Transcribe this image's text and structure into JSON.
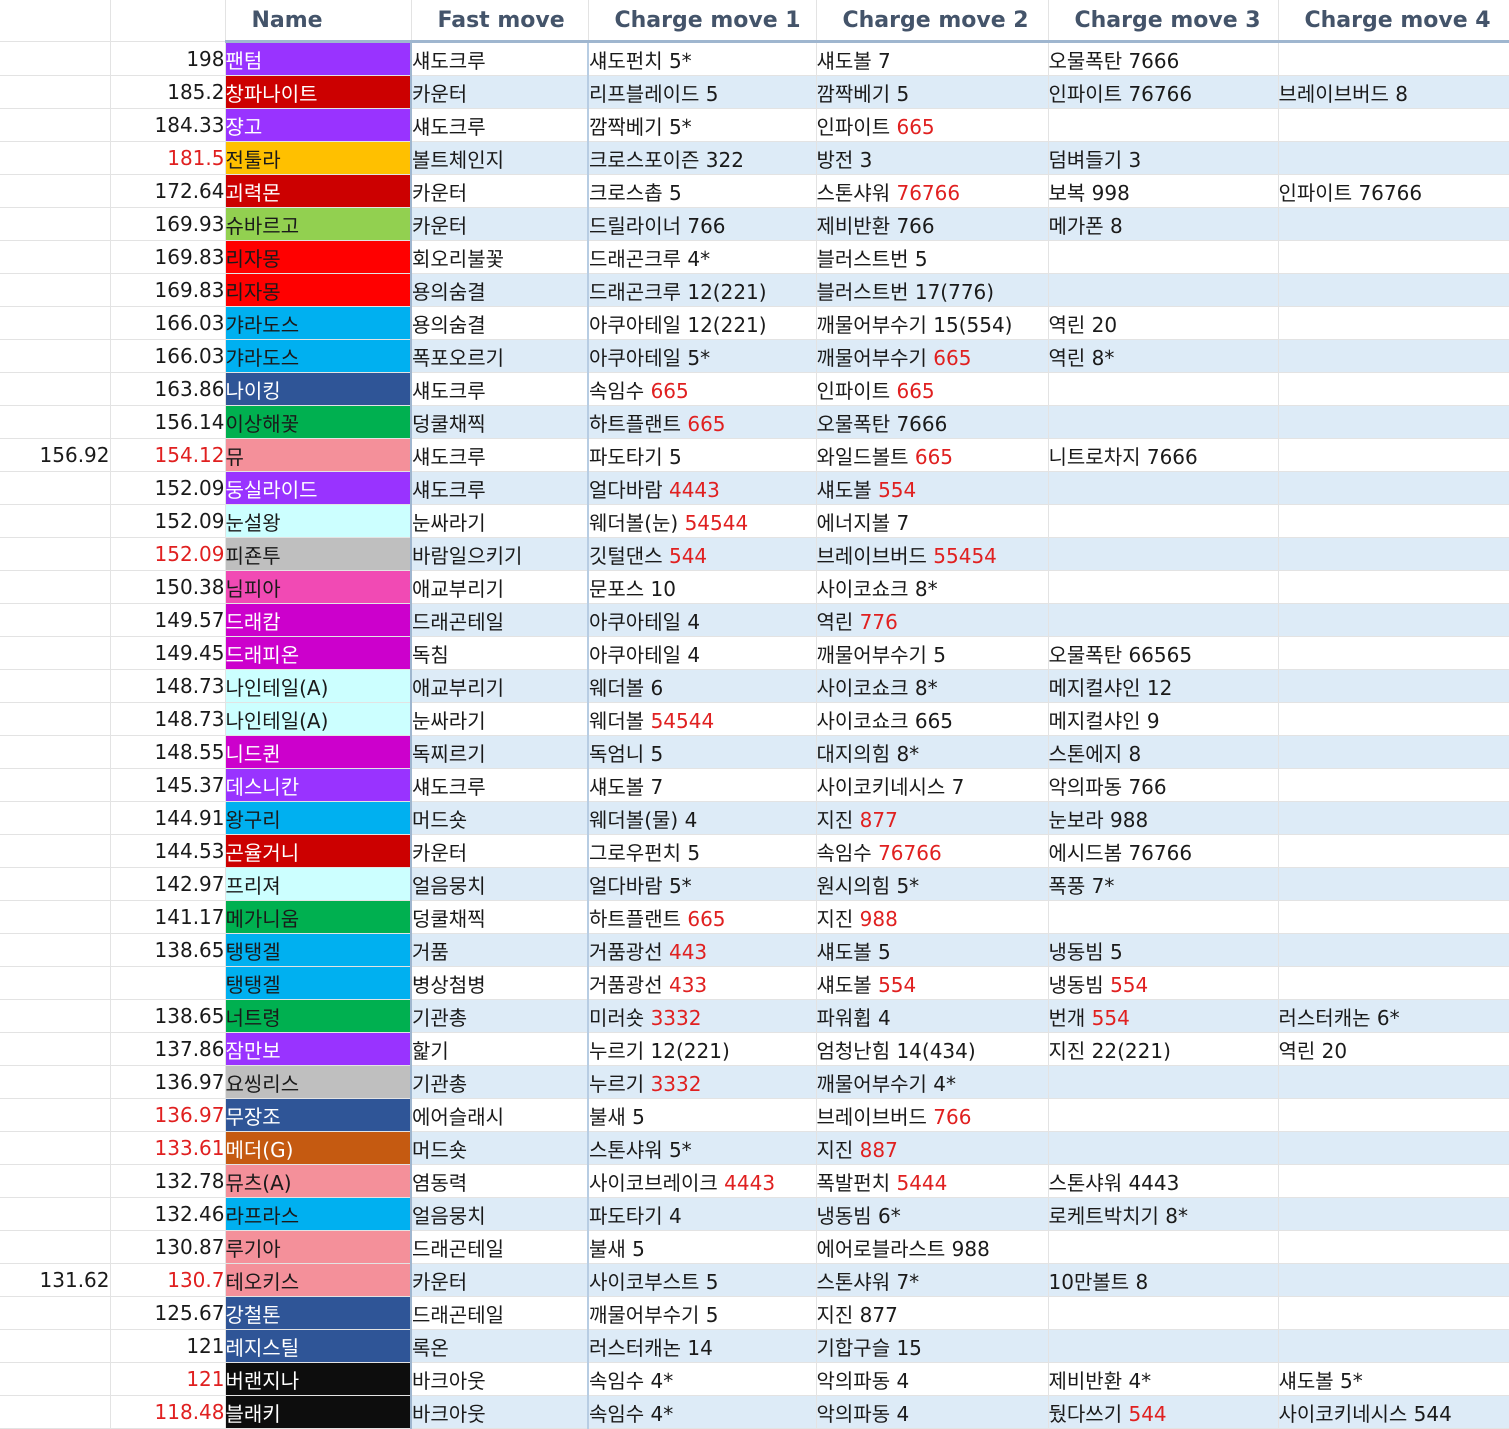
{
  "headers": [
    "",
    "",
    "Name",
    "Fast move",
    "Charge move 1",
    "Charge move 2",
    "Charge move 3",
    "Charge move 4"
  ],
  "rows": [
    {
      "a": "",
      "b": "198",
      "name": "팬텀",
      "color": "#9933ff",
      "fast": "섀도크루",
      "m1": [
        "섀도펀치 5*",
        ""
      ],
      "m2": [
        "섀도볼 7",
        ""
      ],
      "m3": [
        "오물폭탄 7666",
        ""
      ],
      "m4": [
        "",
        ""
      ]
    },
    {
      "a": "",
      "b": "185.2",
      "name": "창파나이트",
      "color": "#cc0000",
      "fast": "카운터",
      "m1": [
        "리프블레이드 5",
        ""
      ],
      "m2": [
        "깜짝베기 5",
        ""
      ],
      "m3": [
        "인파이트 76766",
        ""
      ],
      "m4": [
        "브레이브버드 8",
        ""
      ]
    },
    {
      "a": "",
      "b": "184.33",
      "name": "쟝고",
      "color": "#9933ff",
      "fast": "섀도크루",
      "m1": [
        "깜짝베기 5*",
        ""
      ],
      "m2": [
        "인파이트 ",
        "665"
      ],
      "m3": [
        "",
        ""
      ],
      "m4": [
        "",
        ""
      ]
    },
    {
      "a": "",
      "b": "181.5",
      "bred": true,
      "name": "전툴라",
      "color": "#ffc000",
      "dark": true,
      "fast": "볼트체인지",
      "m1": [
        "크로스포이즌 322",
        ""
      ],
      "m2": [
        "방전 3",
        ""
      ],
      "m3": [
        "덤벼들기 3",
        ""
      ],
      "m4": [
        "",
        ""
      ]
    },
    {
      "a": "",
      "b": "172.64",
      "name": "괴력몬",
      "color": "#cc0000",
      "fast": "카운터",
      "m1": [
        "크로스촙 5",
        ""
      ],
      "m2": [
        "스톤샤워 ",
        "76766"
      ],
      "m3": [
        "보복 998",
        ""
      ],
      "m4": [
        "인파이트 76766",
        ""
      ]
    },
    {
      "a": "",
      "b": "169.93",
      "name": "슈바르고",
      "color": "#92d050",
      "dark": true,
      "fast": "카운터",
      "m1": [
        "드릴라이너 766",
        ""
      ],
      "m2": [
        "제비반환 766",
        ""
      ],
      "m3": [
        "메가폰 8",
        ""
      ],
      "m4": [
        "",
        ""
      ]
    },
    {
      "a": "",
      "b": "169.83",
      "name": "리자몽",
      "color": "#ff0000",
      "dark": true,
      "fast": "회오리불꽃",
      "m1": [
        "드래곤크루 4*",
        ""
      ],
      "m2": [
        "블러스트번 5",
        ""
      ],
      "m3": [
        "",
        ""
      ],
      "m4": [
        "",
        ""
      ]
    },
    {
      "a": "",
      "b": "169.83",
      "name": "리자몽",
      "color": "#ff0000",
      "dark": true,
      "fast": "용의숨결",
      "m1": [
        "드래곤크루 12(221)",
        ""
      ],
      "m2": [
        "블러스트번 17(776)",
        ""
      ],
      "m3": [
        "",
        ""
      ],
      "m4": [
        "",
        ""
      ]
    },
    {
      "a": "",
      "b": "166.03",
      "name": "갸라도스",
      "color": "#00b0f0",
      "dark": true,
      "fast": "용의숨결",
      "m1": [
        "아쿠아테일 12(221)",
        ""
      ],
      "m2": [
        "깨물어부수기 15(554)",
        ""
      ],
      "m3": [
        "역린 20",
        ""
      ],
      "m4": [
        "",
        ""
      ]
    },
    {
      "a": "",
      "b": "166.03",
      "name": "갸라도스",
      "color": "#00b0f0",
      "dark": true,
      "fast": "폭포오르기",
      "m1": [
        "아쿠아테일 5*",
        ""
      ],
      "m2": [
        "깨물어부수기 ",
        "665"
      ],
      "m3": [
        "역린 8*",
        ""
      ],
      "m4": [
        "",
        ""
      ]
    },
    {
      "a": "",
      "b": "163.86",
      "name": "나이킹",
      "color": "#2f5597",
      "fast": "섀도크루",
      "m1": [
        "속임수 ",
        "665"
      ],
      "m2": [
        "인파이트 ",
        "665"
      ],
      "m3": [
        "",
        ""
      ],
      "m4": [
        "",
        ""
      ]
    },
    {
      "a": "",
      "b": "156.14",
      "name": "이상해꽃",
      "color": "#00b050",
      "dark": true,
      "fast": "덩쿨채찍",
      "m1": [
        "하트플랜트 ",
        "665"
      ],
      "m2": [
        "오물폭탄 7666",
        ""
      ],
      "m3": [
        "",
        ""
      ],
      "m4": [
        "",
        ""
      ]
    },
    {
      "a": "156.92",
      "b": "154.12",
      "bred": true,
      "name": "뮤",
      "color": "#f4909a",
      "dark": true,
      "fast": "섀도크루",
      "m1": [
        "파도타기 5",
        ""
      ],
      "m2": [
        "와일드볼트 ",
        "665"
      ],
      "m3": [
        "니트로차지 7666",
        ""
      ],
      "m4": [
        "",
        ""
      ]
    },
    {
      "a": "",
      "b": "152.09",
      "name": "둥실라이드",
      "color": "#9933ff",
      "fast": "섀도크루",
      "m1": [
        "얼다바람 ",
        "4443"
      ],
      "m2": [
        "섀도볼 ",
        "554"
      ],
      "m3": [
        "",
        ""
      ],
      "m4": [
        "",
        ""
      ]
    },
    {
      "a": "",
      "b": "152.09",
      "name": "눈설왕",
      "color": "#ccffff",
      "dark": true,
      "fast": "눈싸라기",
      "m1": [
        "웨더볼(눈) ",
        "54544"
      ],
      "m2": [
        "에너지볼 7",
        ""
      ],
      "m3": [
        "",
        ""
      ],
      "m4": [
        "",
        ""
      ]
    },
    {
      "a": "",
      "b": "152.09",
      "bred": true,
      "name": "피죤투",
      "color": "#bfbfbf",
      "dark": true,
      "fast": "바람일으키기",
      "m1": [
        "깃털댄스 ",
        "544"
      ],
      "m2": [
        "브레이브버드 ",
        "55454"
      ],
      "m3": [
        "",
        ""
      ],
      "m4": [
        "",
        ""
      ]
    },
    {
      "a": "",
      "b": "150.38",
      "name": "님피아",
      "color": "#f14ab4",
      "dark": true,
      "fast": "애교부리기",
      "m1": [
        "문포스 10",
        ""
      ],
      "m2": [
        "사이코쇼크 8*",
        ""
      ],
      "m3": [
        "",
        ""
      ],
      "m4": [
        "",
        ""
      ]
    },
    {
      "a": "",
      "b": "149.57",
      "name": "드래캄",
      "color": "#cc00cc",
      "fast": "드래곤테일",
      "m1": [
        "아쿠아테일 4",
        ""
      ],
      "m2": [
        "역린 ",
        "776"
      ],
      "m3": [
        "",
        ""
      ],
      "m4": [
        "",
        ""
      ]
    },
    {
      "a": "",
      "b": "149.45",
      "name": "드래피온",
      "color": "#cc00cc",
      "fast": "독침",
      "m1": [
        "아쿠아테일 4",
        ""
      ],
      "m2": [
        "깨물어부수기 5",
        ""
      ],
      "m3": [
        "오물폭탄 66565",
        ""
      ],
      "m4": [
        "",
        ""
      ]
    },
    {
      "a": "",
      "b": "148.73",
      "name": "나인테일(A)",
      "color": "#ccffff",
      "dark": true,
      "fast": "애교부리기",
      "m1": [
        "웨더볼 6",
        ""
      ],
      "m2": [
        "사이코쇼크 8*",
        ""
      ],
      "m3": [
        "메지컬샤인 12",
        ""
      ],
      "m4": [
        "",
        ""
      ]
    },
    {
      "a": "",
      "b": "148.73",
      "name": "나인테일(A)",
      "color": "#ccffff",
      "dark": true,
      "fast": "눈싸라기",
      "m1": [
        "웨더볼 ",
        "54544"
      ],
      "m2": [
        "사이코쇼크 665",
        ""
      ],
      "m3": [
        "메지컬샤인 9",
        ""
      ],
      "m4": [
        "",
        ""
      ]
    },
    {
      "a": "",
      "b": "148.55",
      "name": "니드퀸",
      "color": "#cc00cc",
      "fast": "독찌르기",
      "m1": [
        "독엄니 5",
        ""
      ],
      "m2": [
        "대지의힘 8*",
        ""
      ],
      "m3": [
        "스톤에지 8",
        ""
      ],
      "m4": [
        "",
        ""
      ]
    },
    {
      "a": "",
      "b": "145.37",
      "name": "데스니칸",
      "color": "#9933ff",
      "fast": "섀도크루",
      "m1": [
        "섀도볼 7",
        ""
      ],
      "m2": [
        "사이코키네시스 7",
        ""
      ],
      "m3": [
        "악의파동 766",
        ""
      ],
      "m4": [
        "",
        ""
      ]
    },
    {
      "a": "",
      "b": "144.91",
      "name": "왕구리",
      "color": "#00b0f0",
      "dark": true,
      "fast": "머드숏",
      "m1": [
        "웨더볼(물) 4",
        ""
      ],
      "m2": [
        "지진 ",
        "877"
      ],
      "m3": [
        "눈보라 988",
        ""
      ],
      "m4": [
        "",
        ""
      ]
    },
    {
      "a": "",
      "b": "144.53",
      "name": "곤율거니",
      "color": "#cc0000",
      "fast": "카운터",
      "m1": [
        "그로우펀치 5",
        ""
      ],
      "m2": [
        "속임수 ",
        "76766"
      ],
      "m3": [
        "에시드봄 76766",
        ""
      ],
      "m4": [
        "",
        ""
      ]
    },
    {
      "a": "",
      "b": "142.97",
      "name": "프리져",
      "color": "#ccffff",
      "dark": true,
      "fast": "얼음뭉치",
      "m1": [
        "얼다바람 5*",
        ""
      ],
      "m2": [
        "원시의힘 5*",
        ""
      ],
      "m3": [
        "폭풍 7*",
        ""
      ],
      "m4": [
        "",
        ""
      ]
    },
    {
      "a": "",
      "b": "141.17",
      "name": "메가니움",
      "color": "#00b050",
      "dark": true,
      "fast": "덩쿨채찍",
      "m1": [
        "하트플랜트 ",
        "665"
      ],
      "m2": [
        "지진 ",
        "988"
      ],
      "m3": [
        "",
        ""
      ],
      "m4": [
        "",
        ""
      ]
    },
    {
      "a": "",
      "b": "138.65",
      "name": "탱탱겔",
      "color": "#00b0f0",
      "dark": true,
      "fast": "거품",
      "m1": [
        "거품광선 ",
        "443"
      ],
      "m2": [
        "섀도볼 5",
        ""
      ],
      "m3": [
        "냉동빔 5",
        ""
      ],
      "m4": [
        "",
        ""
      ]
    },
    {
      "a": "",
      "b": "",
      "name": "탱탱겔",
      "color": "#00b0f0",
      "dark": true,
      "fast": "병상첨병",
      "m1": [
        "거품광선 ",
        "433"
      ],
      "m2": [
        "섀도볼 ",
        "554"
      ],
      "m3": [
        "냉동빔 ",
        "554"
      ],
      "m4": [
        "",
        ""
      ]
    },
    {
      "a": "",
      "b": "138.65",
      "name": "너트령",
      "color": "#00b050",
      "dark": true,
      "fast": "기관총",
      "m1": [
        "미러숏 ",
        "3332"
      ],
      "m2": [
        "파워휩 4",
        ""
      ],
      "m3": [
        "번개 ",
        "554"
      ],
      "m4": [
        "러스터캐논 6*",
        ""
      ]
    },
    {
      "a": "",
      "b": "137.86",
      "name": "잠만보",
      "color": "#9933ff",
      "fast": "핥기",
      "m1": [
        "누르기 12(221)",
        ""
      ],
      "m2": [
        "엄청난힘 14(434)",
        ""
      ],
      "m3": [
        "지진 22(221)",
        ""
      ],
      "m4": [
        "역린 20",
        ""
      ]
    },
    {
      "a": "",
      "b": "136.97",
      "name": "요씽리스",
      "color": "#bfbfbf",
      "dark": true,
      "fast": "기관총",
      "m1": [
        "누르기 ",
        "3332"
      ],
      "m2": [
        "깨물어부수기 4*",
        ""
      ],
      "m3": [
        "",
        ""
      ],
      "m4": [
        "",
        ""
      ]
    },
    {
      "a": "",
      "b": "136.97",
      "bred": true,
      "name": "무장조",
      "color": "#2f5597",
      "fast": "에어슬래시",
      "m1": [
        "불새 5",
        ""
      ],
      "m2": [
        "브레이브버드 ",
        "766"
      ],
      "m3": [
        "",
        ""
      ],
      "m4": [
        "",
        ""
      ]
    },
    {
      "a": "",
      "b": "133.61",
      "bred": true,
      "name": "메더(G)",
      "color": "#c55a11",
      "fast": "머드숏",
      "m1": [
        "스톤샤워 5*",
        ""
      ],
      "m2": [
        "지진 ",
        "887"
      ],
      "m3": [
        "",
        ""
      ],
      "m4": [
        "",
        ""
      ]
    },
    {
      "a": "",
      "b": "132.78",
      "name": "뮤츠(A)",
      "color": "#f4909a",
      "dark": true,
      "fast": "염동력",
      "m1": [
        "사이코브레이크 ",
        "4443"
      ],
      "m2": [
        "폭발펀치 ",
        "5444"
      ],
      "m3": [
        "스톤샤워 4443",
        ""
      ],
      "m4": [
        "",
        ""
      ]
    },
    {
      "a": "",
      "b": "132.46",
      "name": "라프라스",
      "color": "#00b0f0",
      "dark": true,
      "fast": "얼음뭉치",
      "m1": [
        "파도타기 4",
        ""
      ],
      "m2": [
        "냉동빔 6*",
        ""
      ],
      "m3": [
        "로케트박치기 8*",
        ""
      ],
      "m4": [
        "",
        ""
      ]
    },
    {
      "a": "",
      "b": "130.87",
      "name": "루기아",
      "color": "#f4909a",
      "dark": true,
      "fast": "드래곤테일",
      "m1": [
        "불새 5",
        ""
      ],
      "m2": [
        "에어로블라스트 988",
        ""
      ],
      "m3": [
        "",
        ""
      ],
      "m4": [
        "",
        ""
      ]
    },
    {
      "a": "131.62",
      "b": "130.7",
      "bred": true,
      "name": "테오키스",
      "color": "#f4909a",
      "dark": true,
      "fast": "카운터",
      "m1": [
        "사이코부스트 5",
        ""
      ],
      "m2": [
        "스톤샤워 7*",
        ""
      ],
      "m3": [
        "10만볼트 8",
        ""
      ],
      "m4": [
        "",
        ""
      ]
    },
    {
      "a": "",
      "b": "125.67",
      "name": "강철톤",
      "color": "#2f5597",
      "fast": "드래곤테일",
      "m1": [
        "깨물어부수기 5",
        ""
      ],
      "m2": [
        "지진 877",
        ""
      ],
      "m3": [
        "",
        ""
      ],
      "m4": [
        "",
        ""
      ]
    },
    {
      "a": "",
      "b": "121",
      "name": "레지스틸",
      "color": "#2f5597",
      "fast": "록온",
      "m1": [
        "러스터캐논 14",
        ""
      ],
      "m2": [
        "기합구슬 15",
        ""
      ],
      "m3": [
        "",
        ""
      ],
      "m4": [
        "",
        ""
      ]
    },
    {
      "a": "",
      "b": "121",
      "bred": true,
      "name": "버랜지나",
      "color": "#0d0d0d",
      "fast": "바크아웃",
      "m1": [
        "속임수 4*",
        ""
      ],
      "m2": [
        "악의파동 4",
        ""
      ],
      "m3": [
        "제비반환 4*",
        ""
      ],
      "m4": [
        "섀도볼 5*",
        ""
      ]
    },
    {
      "a": "",
      "b": "118.48",
      "bred": true,
      "name": "블래키",
      "color": "#0d0d0d",
      "fast": "바크아웃",
      "m1": [
        "속임수 4*",
        ""
      ],
      "m2": [
        "악의파동 4",
        ""
      ],
      "m3": [
        "뒀다쓰기 ",
        "544"
      ],
      "m4": [
        "사이코키네시스 544",
        ""
      ]
    }
  ]
}
